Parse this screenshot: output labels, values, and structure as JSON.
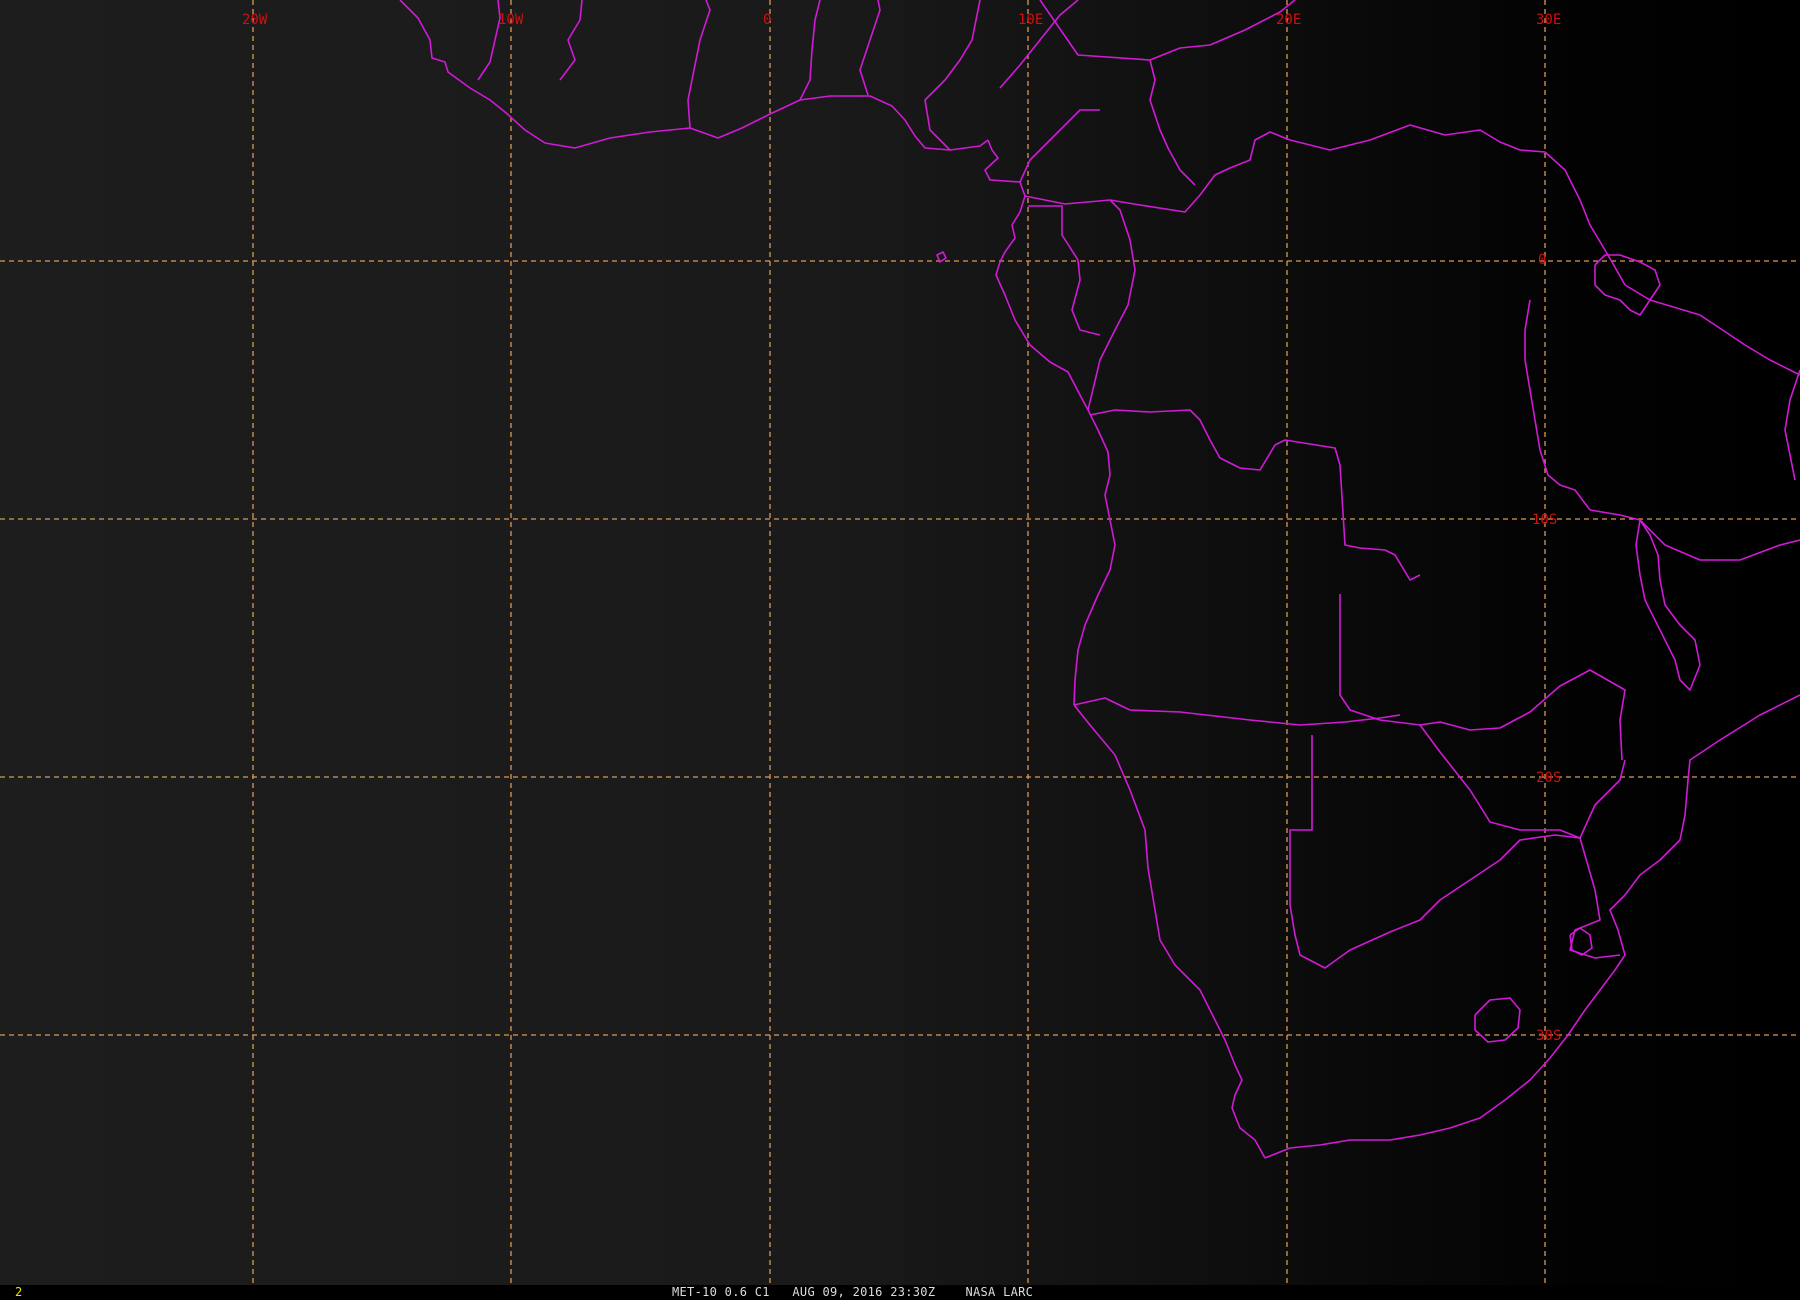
{
  "map": {
    "longitude_labels": [
      "20W",
      "10W",
      "0",
      "10E",
      "20E",
      "30E"
    ],
    "latitude_labels": [
      "0",
      "10S",
      "20S",
      "30S"
    ],
    "grid_color": "#d99a54",
    "label_color": "#cf1010",
    "boundary_color": "#d11ad6",
    "background_color": "#1a1a1a"
  },
  "status": {
    "frame_number": "2",
    "caption": "MET-10 0.6 C1   AUG 09, 2016 23:30Z    NASA LARC"
  }
}
